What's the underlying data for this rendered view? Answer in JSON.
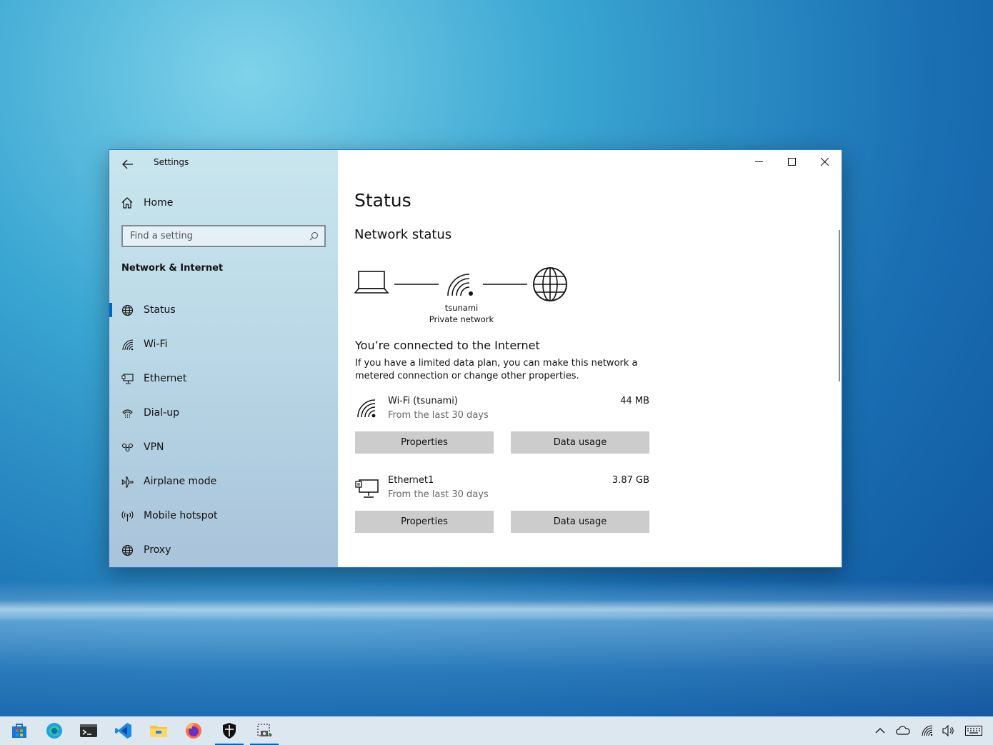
{
  "window": {
    "title": "Settings"
  },
  "sidebar": {
    "home_label": "Home",
    "search_placeholder": "Find a setting",
    "section_title": "Network & Internet",
    "items": [
      {
        "label": "Status",
        "icon": "globe-icon"
      },
      {
        "label": "Wi-Fi",
        "icon": "wifi-icon"
      },
      {
        "label": "Ethernet",
        "icon": "ethernet-icon"
      },
      {
        "label": "Dial-up",
        "icon": "dialup-icon"
      },
      {
        "label": "VPN",
        "icon": "vpn-icon"
      },
      {
        "label": "Airplane mode",
        "icon": "airplane-icon"
      },
      {
        "label": "Mobile hotspot",
        "icon": "hotspot-icon"
      },
      {
        "label": "Proxy",
        "icon": "globe-icon"
      }
    ]
  },
  "main": {
    "title": "Status",
    "network_status_heading": "Network status",
    "network_name": "tsunami",
    "network_type": "Private network",
    "connected_heading": "You’re connected to the Internet",
    "connected_desc": "If you have a limited data plan, you can make this network a metered connection or change other properties.",
    "connections": [
      {
        "name": "Wi-Fi (tsunami)",
        "period": "From the last 30 days",
        "usage": "44 MB",
        "properties_label": "Properties",
        "data_usage_label": "Data usage",
        "icon": "wifi-icon"
      },
      {
        "name": "Ethernet1",
        "period": "From the last 30 days",
        "usage": "3.87 GB",
        "properties_label": "Properties",
        "data_usage_label": "Data usage",
        "icon": "ethernet-icon"
      }
    ]
  },
  "colors": {
    "accent": "#0067c0",
    "button_bg": "#cccccc"
  }
}
